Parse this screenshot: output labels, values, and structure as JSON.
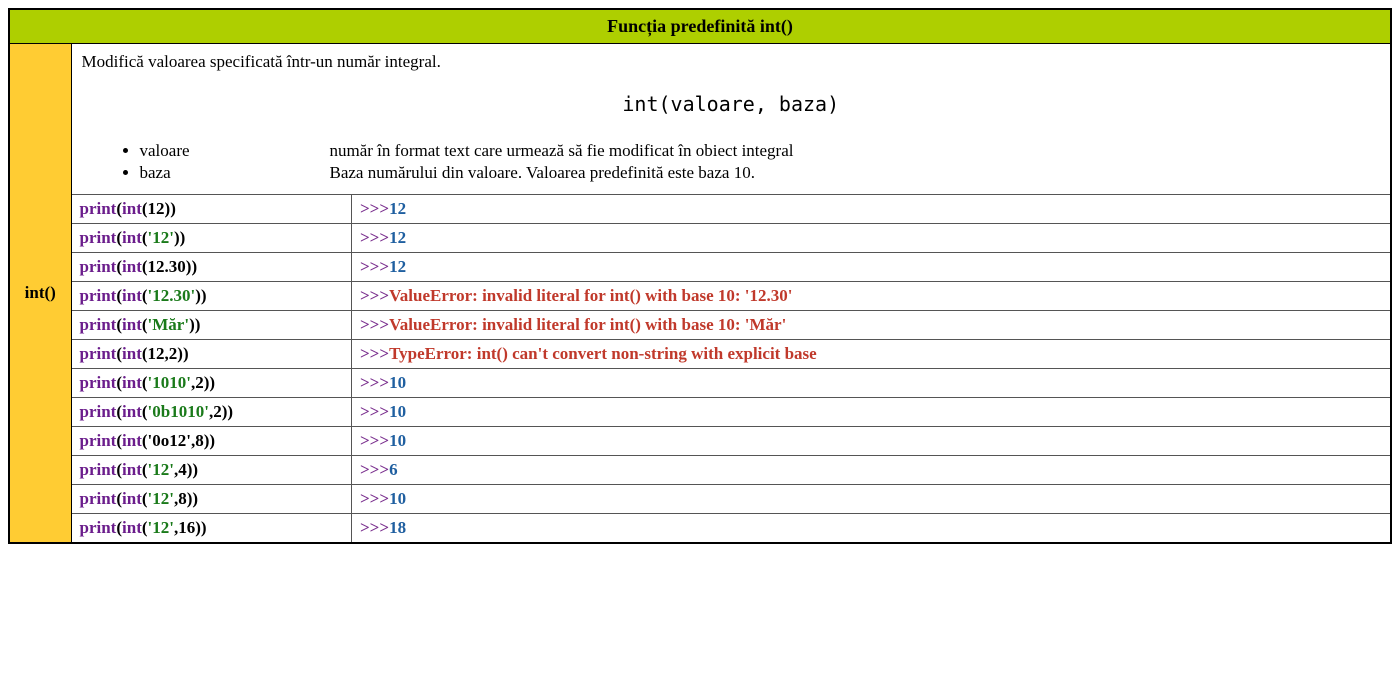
{
  "title": "Funcția predefinită int()",
  "sidelabel": "int()",
  "description": "Modifică valoarea specificată într-un număr integral.",
  "signature": "int(valoare, baza)",
  "params": [
    {
      "name": "valoare",
      "desc": "număr în format text care urmează să fie modificat în obiect integral"
    },
    {
      "name": "baza",
      "desc": "Baza numărului din valoare. Valoarea predefinită este baza 10."
    }
  ],
  "kw_print": "print",
  "kw_int": "int",
  "lp": "(",
  "rp": ")",
  "comma": ",",
  "prompt": ">>>",
  "rows": [
    {
      "arg_type": "num",
      "arg": "12",
      "base": null,
      "out_kind": "ok",
      "out": "12"
    },
    {
      "arg_type": "str",
      "arg": "'12'",
      "base": null,
      "out_kind": "ok",
      "out": "12"
    },
    {
      "arg_type": "num",
      "arg": "12.30",
      "base": null,
      "out_kind": "ok",
      "out": "12"
    },
    {
      "arg_type": "str",
      "arg": "'12.30'",
      "base": null,
      "out_kind": "err",
      "out": "ValueError: invalid literal for int() with base 10: '12.30'"
    },
    {
      "arg_type": "str",
      "arg": "'Măr'",
      "base": null,
      "out_kind": "err",
      "out": "ValueError: invalid literal for int() with base 10: 'Măr'"
    },
    {
      "arg_type": "num",
      "arg": "12",
      "base": "2",
      "out_kind": "err",
      "out": "TypeError: int() can't convert non-string with explicit base"
    },
    {
      "arg_type": "str",
      "arg": "'1010'",
      "base": "2",
      "out_kind": "ok",
      "out": "10"
    },
    {
      "arg_type": "str",
      "arg": "'0b1010'",
      "base": "2",
      "out_kind": "ok",
      "out": "10"
    },
    {
      "arg_type": "plain",
      "arg": "'0o12'",
      "base": "8",
      "out_kind": "ok",
      "out": "10"
    },
    {
      "arg_type": "str",
      "arg": "'12'",
      "base": "4",
      "out_kind": "ok",
      "out": "6"
    },
    {
      "arg_type": "str",
      "arg": "'12'",
      "base": "8",
      "out_kind": "ok",
      "out": "10"
    },
    {
      "arg_type": "str",
      "arg": "'12'",
      "base": "16",
      "out_kind": "ok",
      "out": "18"
    }
  ]
}
